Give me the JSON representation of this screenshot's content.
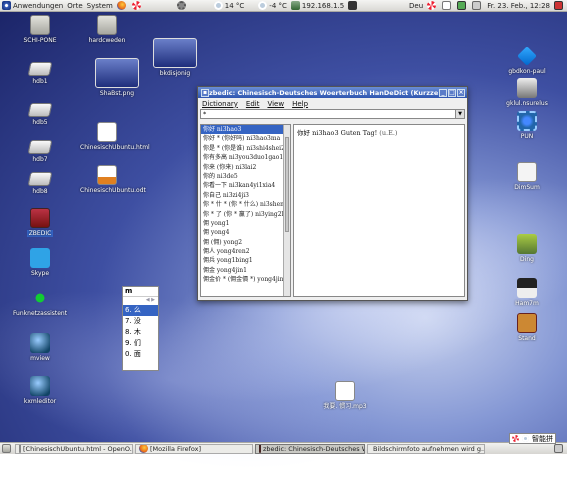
{
  "top_panel": {
    "applications": "Anwendungen",
    "places": "Orte",
    "system": "System",
    "weather1": "14 °C",
    "weather2": "-4 °C",
    "ip": "192.168.1.5",
    "locale": "Deu",
    "datetime": "Fr. 23. Feb., 12:28"
  },
  "desktop_icons": [
    {
      "label": "SCHI-PONE"
    },
    {
      "label": "hardcweden"
    },
    {
      "label": "bkdisjonig"
    },
    {
      "label": "hdb1"
    },
    {
      "label": "ShaBst.png"
    },
    {
      "label": "hdb5"
    },
    {
      "label": "hdb7"
    },
    {
      "label": "ChinesischUbuntu.html"
    },
    {
      "label": "hdb8"
    },
    {
      "label": "ChinesischUbuntu.odt"
    },
    {
      "label": "ZBEDIC"
    },
    {
      "label": "Skype"
    },
    {
      "label": "Funknetzassistent"
    },
    {
      "label": "mview"
    },
    {
      "label": "kxmleditor"
    },
    {
      "label": "gbdkon-paul"
    },
    {
      "label": "gklul.nsurelus"
    },
    {
      "label": "PUN"
    },
    {
      "label": "DimSum"
    },
    {
      "label": "Ding"
    },
    {
      "label": "Ham7m"
    },
    {
      "label": "Stand"
    },
    {
      "label": "我要. 惯习.mp3"
    }
  ],
  "window": {
    "title": "zbedic: Chinesisch-Deutsches Woerterbuch HanDeDict (Kurzzeichen)",
    "menu": [
      "Dictionary",
      "Edit",
      "View",
      "Help"
    ],
    "search_value": "*",
    "list": [
      "你好 ni3hao3",
      "你好 * (你好吗) ni3hao3ma",
      "你是 * (你是谁) ni3shi4shei2",
      "你有多高 ni3you3duo1gao1",
      "你来 (你来) ni3lai2",
      "你的 ni3de5",
      "你看一下 ni3kan4yi1xia4",
      "你自己 ni3zi4ji3",
      "你 * 什 * (你 * 什么) ni3shenme",
      "你 * 了 (你 * 赢了) ni3ying2le5",
      "佣 yong1",
      "佣 yong4",
      "佣 (佣) yong2",
      "佣人 yong4ren2",
      "佣兵 yong1bing1",
      "佣金 yong4jin1",
      "佣金价 * (佣金價 *) yong4jin"
    ],
    "detail_head": "你好 ni3hao3 Guten Tag! ",
    "detail_note": "(u.E.)"
  },
  "ime": {
    "header": "m",
    "candidates": [
      "6. 么",
      "7. 没",
      "8. 木",
      "9. 们",
      "0. 面"
    ]
  },
  "taskbar": [
    "[ChinesischUbuntu.html - OpenO...",
    "[Mozilla Firefox]",
    "zbedic: Chinesisch-Deutsches W...",
    "Bildschirmfoto aufnehmen wird g..."
  ],
  "tray": {
    "ime_label": "智能拼"
  }
}
